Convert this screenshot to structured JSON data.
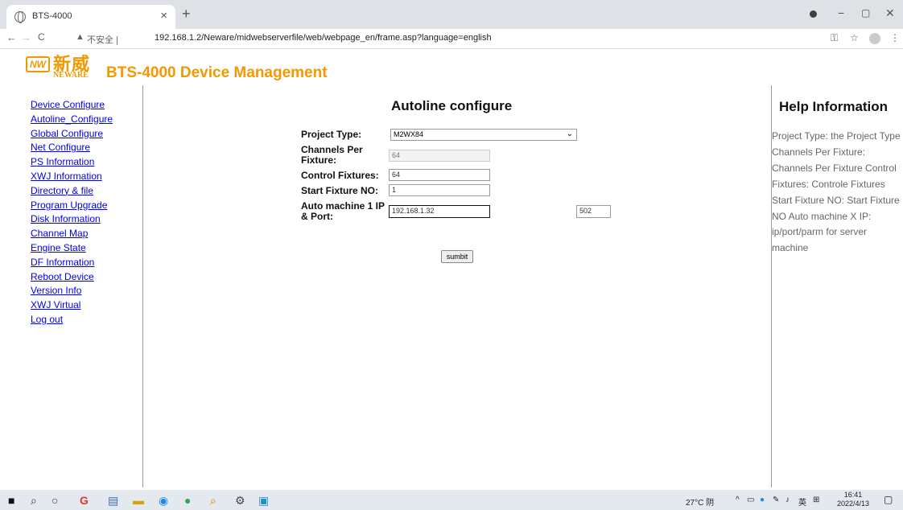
{
  "browser": {
    "tab_title": "BTS-4000",
    "tab_close": "×",
    "new_tab": "+",
    "insecure_label": "不安全",
    "separator": "|",
    "url": "192.168.1.2/Neware/midwebserverfile/web/webpage_en/frame.asp?language=english",
    "icons": [
      "back-icon",
      "forward-icon",
      "reload-icon",
      "warning-icon",
      "key-icon",
      "star-icon",
      "profile-icon",
      "menu-icon"
    ]
  },
  "logo": {
    "mark": "NW",
    "cn_text": "新威",
    "en_text": "NEWARE",
    "title": "BTS-4000 Device Management"
  },
  "menu": {
    "items": [
      "Device Configure",
      "Autoline_Configure",
      "Global Configure",
      "Net Configure",
      "PS Information",
      "XWJ Information",
      "Directory & file",
      "Program Upgrade",
      "Disk Information",
      "Channel Map",
      "Engine State",
      "DF Information",
      "Reboot Device",
      "Version Info",
      "XWJ Virtual",
      "Log out"
    ]
  },
  "form": {
    "title": "Autoline configure",
    "project_type_label": "Project Type:",
    "project_type_value": "M2WX84",
    "channels_label": "Channels Per Fixture:",
    "channels_value": "64",
    "control_fixtures_label": "Control Fixtures:",
    "control_fixtures_value": "64",
    "start_fixture_label": "Start Fixture NO:",
    "start_fixture_value": "1",
    "auto_machine_label": "Auto machine 1 IP & Port:",
    "auto_machine_ip": "192.168.1.32",
    "auto_machine_port": "502",
    "submit_label": "sumbit"
  },
  "help": {
    "title": "Help Information",
    "text": "Project Type: the Project Type Channels Per Fixture: Channels Per Fixture Control Fixtures: Controle Fixtures Start Fixture NO: Start Fixture NO Auto machine X IP: ip/port/parm for server machine"
  },
  "taskbar": {
    "tray_text": "27°C 阴",
    "ime": "英",
    "time": "16:41",
    "date": "2022/4/13"
  }
}
